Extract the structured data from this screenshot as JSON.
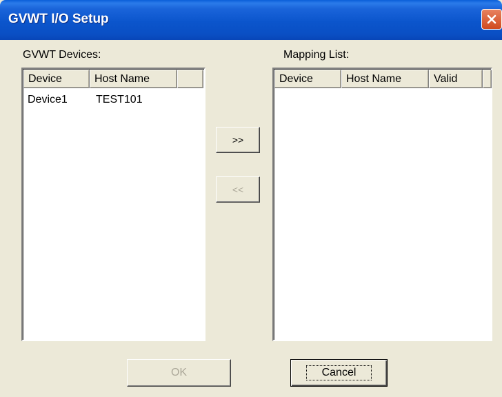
{
  "window": {
    "title": "GVWT I/O Setup"
  },
  "devices": {
    "label": "GVWT Devices:",
    "columns": [
      "Device",
      "Host Name"
    ],
    "rows": [
      {
        "device": "Device1",
        "host": "TEST101"
      }
    ]
  },
  "mapping": {
    "label": "Mapping List:",
    "columns": [
      "Device",
      "Host Name",
      "Valid"
    ],
    "rows": []
  },
  "buttons": {
    "add": ">>",
    "remove": "<<",
    "ok": "OK",
    "cancel": "Cancel"
  },
  "icons": {
    "close": "close-icon"
  },
  "colors": {
    "titlebar": "#0A4FC4",
    "dialog": "#ECE9D8",
    "close": "#D04A1E"
  }
}
